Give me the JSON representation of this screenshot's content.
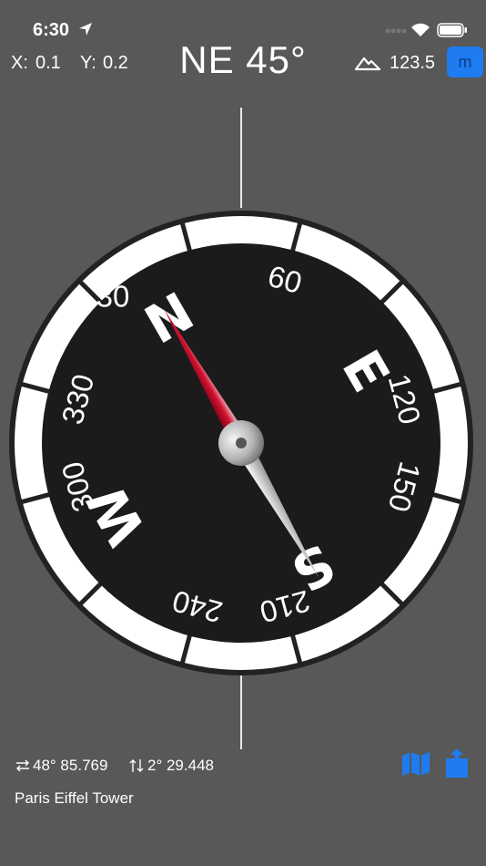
{
  "status_bar": {
    "time": "6:30"
  },
  "header": {
    "x_label": "X:",
    "x_value": "0.1",
    "y_label": "Y:",
    "y_value": "0.2",
    "heading": "NE 45°",
    "altitude": "123.5",
    "unit_button": "m"
  },
  "compass": {
    "cardinals": [
      "N",
      "E",
      "S",
      "W"
    ],
    "degree_labels": [
      "30",
      "60",
      "120",
      "150",
      "210",
      "240",
      "300",
      "330"
    ],
    "needle_heading_deg": 330
  },
  "footer": {
    "latitude": "48° 85.769",
    "longitude": "2° 29.448",
    "place": "Paris Eiffel Tower"
  },
  "colors": {
    "background": "#585858",
    "accent": "#1e7cf0",
    "needle_north": "#c8102e"
  }
}
